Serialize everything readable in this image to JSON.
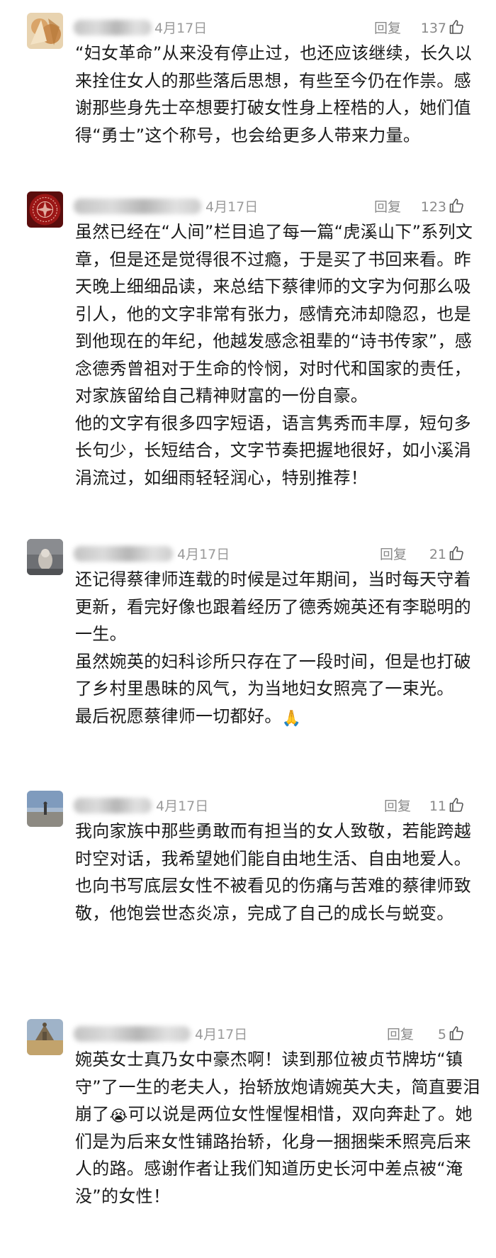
{
  "comments": [
    {
      "date": "4月17日",
      "reply": "回复",
      "likes": "137",
      "paragraphs": [
        "“妇女革命”从来没有停止过，也还应该继续，长久以来拴住女人的那些落后思想，有些至今仍在作祟。感谢那些身先士卒想要打破女性身上桎梏的人，她们值得“勇士”这个称号，也会给更多人带来力量。"
      ]
    },
    {
      "date": "4月17日",
      "reply": "回复",
      "likes": "123",
      "paragraphs": [
        "虽然已经在“人间”栏目追了每一篇“虎溪山下”系列文章，但是还是觉得很不过瘾，于是买了书回来看。昨天晚上细细品读，来总结下蔡律师的文字为何那么吸引人，他的文字非常有张力，感情充沛却隐忍，也是到他现在的年纪，他越发感念祖辈的“诗书传家”，感念德秀曾祖对于生命的怜悯，对时代和国家的责任，对家族留给自己精神财富的一份自豪。",
        "他的文字有很多四字短语，语言隽秀而丰厚，短句多长句少，长短结合，文字节奏把握地很好，如小溪涓涓流过，如细雨轻轻润心，特别推荐！"
      ]
    },
    {
      "date": "4月17日",
      "reply": "回复",
      "likes": "21",
      "paragraphs": [
        "还记得蔡律师连载的时候是过年期间，当时每天守着更新，看完好像也跟着经历了德秀婉英还有李聪明的一生。",
        "虽然婉英的妇科诊所只存在了一段时间，但是也打破了乡村里愚昧的风气，为当地妇女照亮了一束光。",
        "最后祝愿蔡律师一切都好。"
      ],
      "emoji": "🙏"
    },
    {
      "date": "4月17日",
      "reply": "回复",
      "likes": "11",
      "paragraphs": [
        "我向家族中那些勇敢而有担当的女人致敬，若能跨越时空对话，我希望她们能自由地生活、自由地爱人。",
        "也向书写底层女性不被看见的伤痛与苦难的蔡律师致敬，他饱尝世态炎凉，完成了自己的成长与蜕变。"
      ]
    },
    {
      "date": "4月17日",
      "reply": "回复",
      "likes": "5",
      "paragraphs_before_emoji": "婉英女士真乃女中豪杰啊！读到那位被贞节牌坊“镇守”了一生的老夫人，抬轿放炮请婉英大夫，简直要泪崩了",
      "emoji": "😭",
      "paragraphs_after_emoji": "可以说是两位女性惺惺相惜，双向奔赴了。她们是为后来女性铺路抬轿，化身一捆捆柴禾照亮后来人的路。感谢作者让我们知道历史长河中差点被“淹没”的女性！"
    }
  ],
  "icons": {
    "like": "thumbs-up-icon"
  },
  "colors": {
    "meta_text": "#9b9b9b",
    "body_text": "#1a1a1a"
  }
}
